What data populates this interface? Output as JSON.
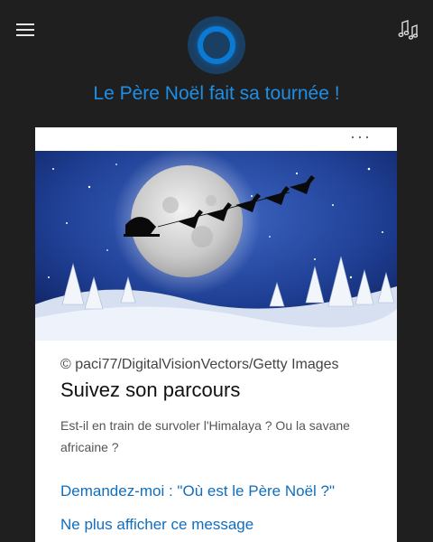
{
  "header": {
    "menu_icon": "hamburger-menu-icon",
    "music_icon": "music-notes-icon",
    "assistant_icon": "cortana-circle-icon",
    "accent_color": "#1f8fe6"
  },
  "headline": "Le Père Noël fait sa tournée !",
  "card": {
    "more_icon": "more-options-icon",
    "more_label": "···",
    "image_icon": "santa-sleigh-moon-image",
    "credit": "© paci77/DigitalVisionVectors/Getty Images",
    "title": "Suivez son parcours",
    "description": "Est-il en train de survoler l'Himalaya ? Ou la savane africaine ?",
    "link_ask": "Demandez-moi : \"Où est le Père Noël ?\"",
    "link_dismiss": "Ne plus afficher ce message",
    "link_color": "#106ebe"
  }
}
